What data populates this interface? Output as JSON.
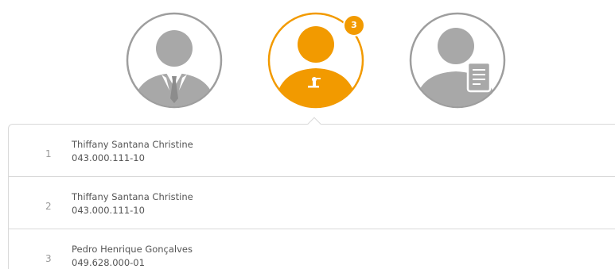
{
  "avatars": [
    {
      "name": "user-suit-icon",
      "active": false
    },
    {
      "name": "user-support-icon",
      "active": true,
      "badge": "3"
    },
    {
      "name": "user-document-icon",
      "active": false
    }
  ],
  "colors": {
    "active": "#f29a00",
    "inactive": "#a8a8a8",
    "ring": "#9e9e9e",
    "divider": "#d9d9d9"
  },
  "list": [
    {
      "index": "1",
      "name": "Thiffany Santana Christine",
      "id": "043.000.111-10"
    },
    {
      "index": "2",
      "name": "Thiffany Santana Christine",
      "id": "043.000.111-10"
    },
    {
      "index": "3",
      "name": "Pedro Henrique Gonçalves",
      "id": "049.628.000-01"
    }
  ]
}
